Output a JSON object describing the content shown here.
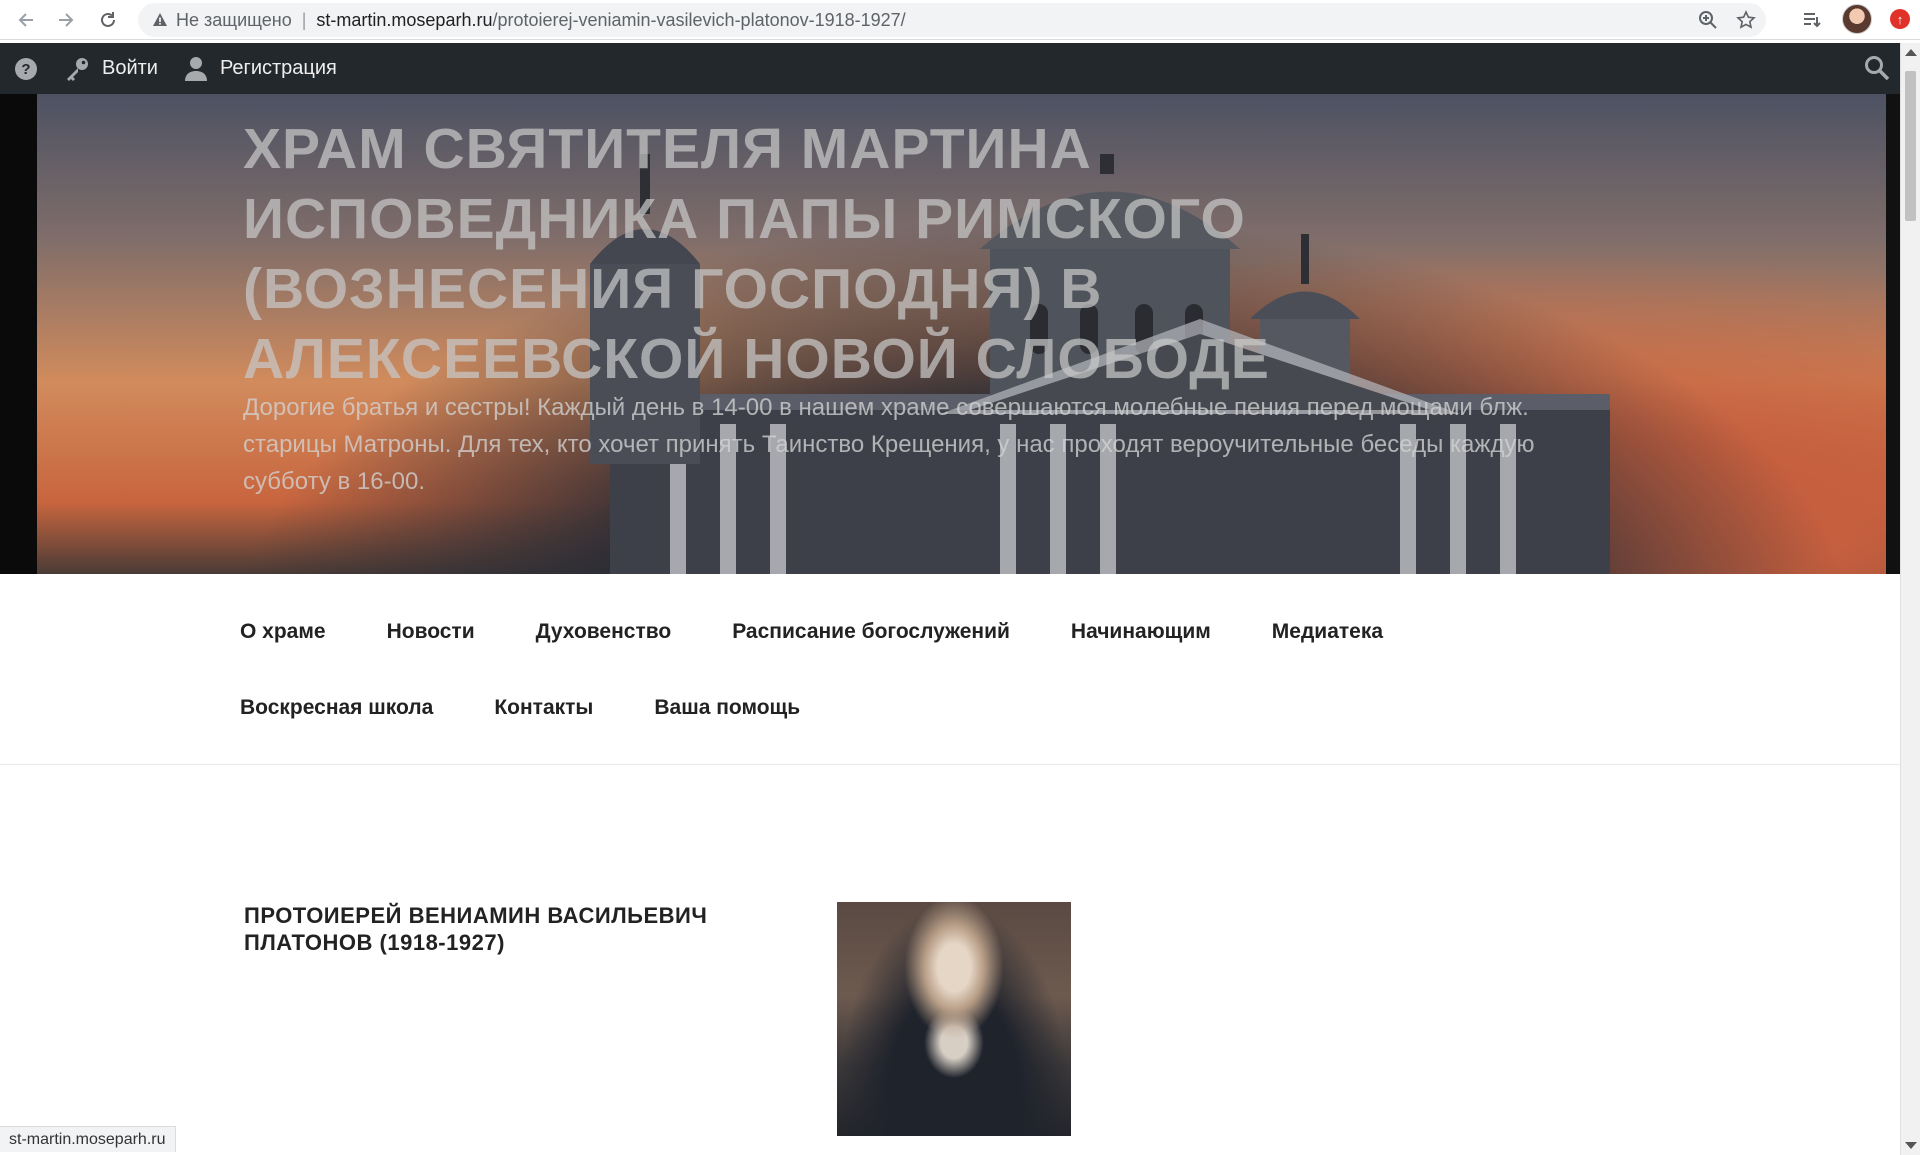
{
  "browser": {
    "security_label": "Не защищено",
    "url_host": "st-martin.moseparh.ru",
    "url_path": "/protoierej-veniamin-vasilevich-platonov-1918-1927/",
    "status_url": "st-martin.moseparh.ru"
  },
  "admin_bar": {
    "login_label": "Войти",
    "register_label": "Регистрация"
  },
  "header": {
    "site_title": "Храм святителя Мартина Исповедника Папы Римского (Вознесения Господня) в Алексеевской Новой Слободе",
    "site_description": "Дорогие братья и сестры! Каждый день в 14-00 в нашем храме совершаются молебные пения перед мощами блж. старицы Матроны. Для тех, кто хочет принять Таинство Крещения, у нас проходят вероучительные беседы каждую субботу в 16-00."
  },
  "menu": {
    "row1": [
      "О храме",
      "Новости",
      "Духовенство",
      "Расписание богослужений",
      "Начинающим",
      "Медиатека"
    ],
    "row2": [
      "Воскресная школа",
      "Контакты",
      "Ваша помощь"
    ]
  },
  "content": {
    "entry_title": "Протоиерей Вениамин Васильевич Платонов (1918-1927)"
  }
}
